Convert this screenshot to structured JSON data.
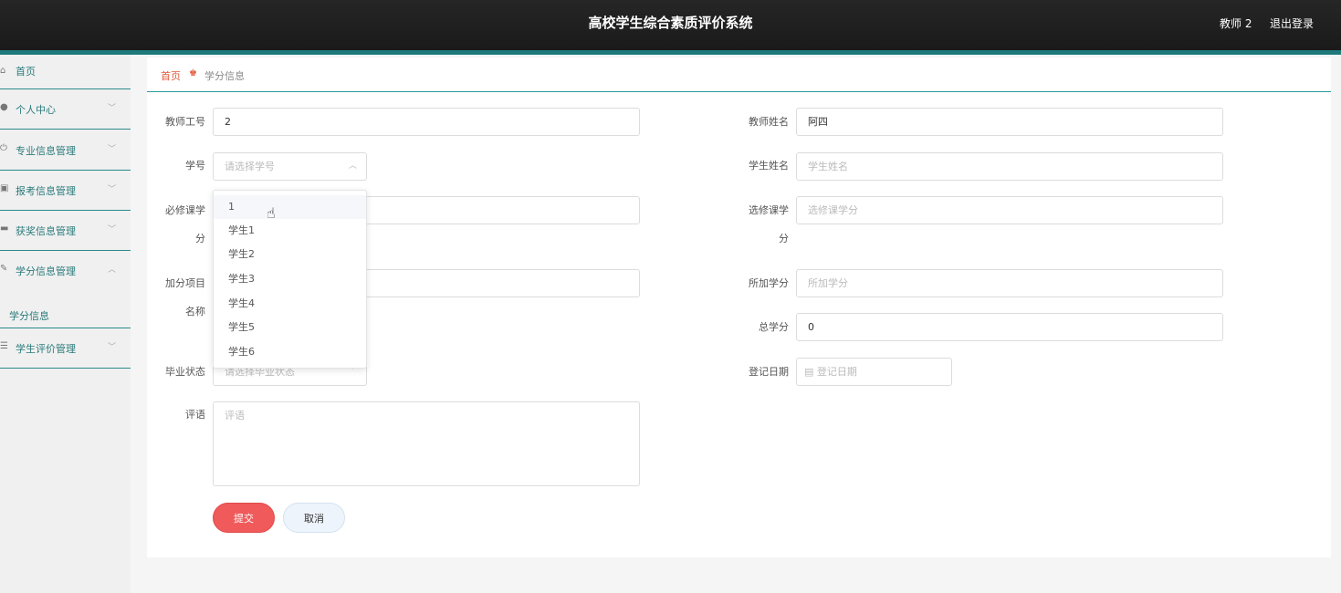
{
  "header": {
    "title": "高校学生综合素质评价系统",
    "user": "教师 2",
    "logout": "退出登录"
  },
  "sidebar": {
    "items": [
      {
        "label": "首页",
        "icon": "home-icon"
      },
      {
        "label": "个人中心",
        "icon": "user-icon"
      },
      {
        "label": "专业信息管理",
        "icon": "power-icon"
      },
      {
        "label": "报考信息管理",
        "icon": "calendar-icon"
      },
      {
        "label": "获奖信息管理",
        "icon": "monitor-icon"
      },
      {
        "label": "学分信息管理",
        "icon": "edit-icon"
      },
      {
        "label": "学生评价管理",
        "icon": "sliders-icon"
      }
    ],
    "sub_item": "学分信息"
  },
  "breadcrumb": {
    "home": "首页",
    "current": "学分信息"
  },
  "form": {
    "teacher_id_label": "教师工号",
    "teacher_id_value": "2",
    "teacher_name_label": "教师姓名",
    "teacher_name_value": "阿四",
    "student_id_label": "学号",
    "student_id_placeholder": "请选择学号",
    "student_name_label": "学生姓名",
    "student_name_placeholder": "学生姓名",
    "required_credit_label_1": "必修课学",
    "required_credit_label_2": "分",
    "elective_credit_label_1": "选修课学",
    "elective_credit_label_2": "分",
    "elective_credit_placeholder": "选修课学分",
    "bonus_item_label_1": "加分项目",
    "bonus_item_label_2": "名称",
    "bonus_credit_label": "所加学分",
    "bonus_credit_placeholder": "所加学分",
    "total_credit_label": "总学分",
    "total_credit_value": "0",
    "graduation_label": "毕业状态",
    "graduation_placeholder": "请选择毕业状态",
    "reg_date_label": "登记日期",
    "reg_date_placeholder": "登记日期",
    "comment_label": "评语",
    "comment_placeholder": "评语",
    "submit": "提交",
    "cancel": "取消"
  },
  "dropdown": {
    "options": [
      "1",
      "学生1",
      "学生2",
      "学生3",
      "学生4",
      "学生5",
      "学生6"
    ],
    "hovered": "1"
  }
}
